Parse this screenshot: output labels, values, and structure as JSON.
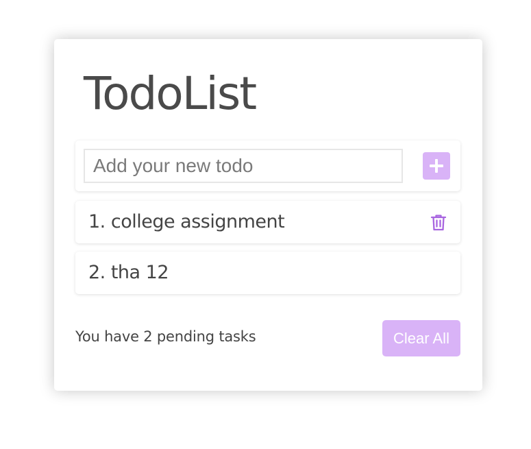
{
  "app": {
    "title": "TodoList"
  },
  "input": {
    "placeholder": "Add your new todo",
    "value": "",
    "add_icon": "plus-icon"
  },
  "todos": [
    {
      "label": "1. college assignment",
      "delete_icon": "trash-icon"
    },
    {
      "label": "2. tha 12"
    }
  ],
  "footer": {
    "pending_text": "You have 2 pending tasks",
    "clear_label": "Clear All"
  },
  "colors": {
    "accent": "#d9b3f7",
    "icon_accent": "#a865e0",
    "text": "#444444"
  }
}
